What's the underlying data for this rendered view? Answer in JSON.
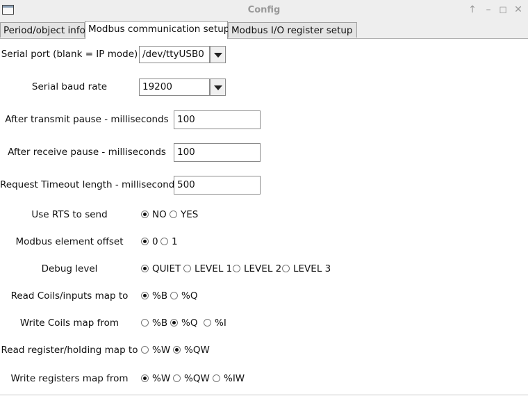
{
  "window": {
    "title": "Config",
    "pin_glyph": "↑",
    "minimize_glyph": "–",
    "maximize_glyph": "◻",
    "close_glyph": "✕"
  },
  "tabs": [
    "Period/object info",
    "Modbus communication setup",
    "Modbus  I/O register setup"
  ],
  "serial_port": {
    "label": "Serial port (blank = IP mode)",
    "value": "/dev/ttyUSB0"
  },
  "baud_rate": {
    "label": "Serial baud rate",
    "value": "19200"
  },
  "after_transmit": {
    "label": "After transmit pause - milliseconds",
    "value": "100"
  },
  "after_receive": {
    "label": "After receive pause - milliseconds",
    "value": "100"
  },
  "request_timeout": {
    "label": "Request Timeout length - milliseconds",
    "value": "500"
  },
  "rts": {
    "label": "Use RTS to send",
    "options": [
      "NO",
      "YES"
    ],
    "selected": "NO"
  },
  "element_offset": {
    "label": "Modbus element offset",
    "options": [
      "0",
      "1"
    ],
    "selected": "0"
  },
  "debug_level": {
    "label": "Debug level",
    "options": [
      "QUIET",
      "LEVEL 1",
      "LEVEL 2",
      "LEVEL 3"
    ],
    "selected": "QUIET"
  },
  "read_coils": {
    "label": "Read Coils/inputs map to",
    "options": [
      "%B",
      "%Q"
    ],
    "selected": "%B"
  },
  "write_coils": {
    "label": "Write Coils map from",
    "options": [
      "%B",
      "%Q",
      "%I"
    ],
    "selected": "%Q"
  },
  "read_register": {
    "label": "Read register/holding map to",
    "options": [
      "%W",
      "%QW"
    ],
    "selected": "%QW"
  },
  "write_registers": {
    "label": "Write registers map from",
    "options": [
      "%W",
      "%QW",
      "%IW"
    ],
    "selected": "%W"
  }
}
